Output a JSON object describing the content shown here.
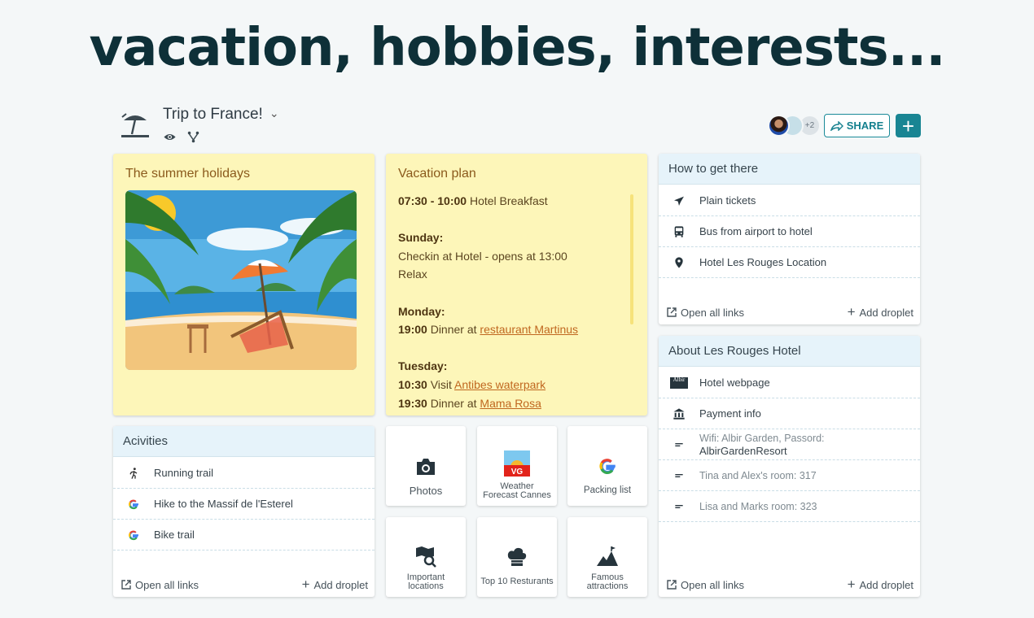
{
  "headline": "vacation, hobbies, interests...",
  "board": {
    "title": "Trip to France!",
    "extra_collaborators": "+2",
    "share_label": "SHARE",
    "add_label": "+"
  },
  "summer_note": {
    "title": "The summer holidays"
  },
  "vacation_plan": {
    "title": "Vacation plan",
    "lines": [
      {
        "bold": "07:30 - 10:00",
        "text": " Hotel Breakfast"
      },
      {
        "bold": "",
        "text": ""
      },
      {
        "bold": "Sunday:",
        "text": ""
      },
      {
        "bold": "",
        "text": "Checkin at Hotel - opens at 13:00"
      },
      {
        "bold": "",
        "text": "Relax"
      },
      {
        "bold": "",
        "text": ""
      },
      {
        "bold": "Monday:",
        "text": ""
      },
      {
        "bold": "19:00",
        "text": " Dinner at ",
        "link": "restaurant Martinus"
      },
      {
        "bold": "",
        "text": ""
      },
      {
        "bold": "Tuesday:",
        "text": ""
      },
      {
        "bold": "10:30",
        "text": " Visit ",
        "link": "Antibes waterpark"
      },
      {
        "bold": "19:30",
        "text": " Dinner at ",
        "link": "Mama Rosa"
      }
    ]
  },
  "activities": {
    "title": "Acivities",
    "items": [
      "Running trail",
      "Hike to the Massif de l'Esterel",
      "Bike trail"
    ],
    "open_all": "Open all links",
    "add_droplet": "Add droplet"
  },
  "tiles": [
    {
      "label": "Photos",
      "icon": "camera-icon"
    },
    {
      "label": "Weather Forecast Cannes",
      "icon": "vg-weather-icon"
    },
    {
      "label": "Packing list",
      "icon": "google-icon"
    },
    {
      "label": "Important locations",
      "icon": "map-search-icon"
    },
    {
      "label": "Top 10 Resturants",
      "icon": "chef-hat-icon"
    },
    {
      "label": "Famous attractions",
      "icon": "mountain-flag-icon"
    }
  ],
  "how_to_get_there": {
    "title": "How to get there",
    "items": [
      "Plain tickets",
      "Bus from airport to hotel",
      "Hotel Les Rouges Location"
    ],
    "open_all": "Open all links",
    "add_droplet": "Add droplet"
  },
  "about_hotel": {
    "title": "About Les Rouges Hotel",
    "items": [
      {
        "text": "Hotel webpage"
      },
      {
        "text": "Payment info"
      },
      {
        "text": "Wifi: Albir Garden, Passord:",
        "text2": "AlbirGardenResort"
      },
      {
        "text": "Tina and Alex's room: 317"
      },
      {
        "text": "Lisa and Marks room: 323"
      }
    ],
    "logo_text": "Albir",
    "open_all": "Open all links",
    "add_droplet": "Add droplet"
  },
  "colors": {
    "headline": "#0e3038",
    "accent": "#198593",
    "note": "#fdf6b9",
    "note_title": "#8b5a1c",
    "link": "#c0671f"
  }
}
